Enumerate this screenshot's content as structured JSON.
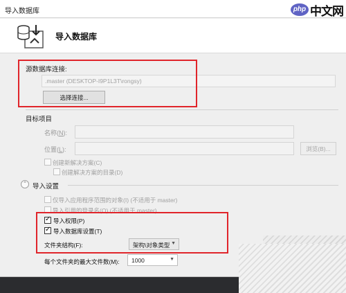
{
  "window": {
    "title": "导入数据库"
  },
  "watermark": {
    "badge": "php",
    "text": "中文网"
  },
  "header": {
    "title": "导入数据库",
    "icon": "database-import-icon"
  },
  "source": {
    "label": "源数据库连接:",
    "connection": ".master (DESKTOP-I9P1L3T\\rongsy)",
    "select_button": "选择连接..."
  },
  "target": {
    "label": "目标项目",
    "name_label": "名称(",
    "name_key": "N",
    "name_suffix": "):",
    "location_label": "位置(",
    "location_key": "L",
    "location_suffix": "):",
    "browse_button": "浏览(B)...",
    "create_solution": "创建新解决方案(C)",
    "create_solution_dir": "创建解决方案的目录(D)"
  },
  "import_settings": {
    "label": "导入设置",
    "import_app_scope": "仅导入应用程序范围的对象(I) (不适用于 master)",
    "import_refs": "导入引用的登录名(O) (不适用于 master)",
    "import_permissions": "导入权限(P)",
    "import_db_settings": "导入数据库设置(T)",
    "folder_structure_label": "文件夹结构(F):",
    "folder_structure_value": "架构\\对象类型",
    "max_files_label": "每个文件夹的最大文件数(M):",
    "max_files_value": "1000"
  },
  "colors": {
    "highlight": "#e0242a",
    "watermark_badge": "#5f63c4"
  }
}
